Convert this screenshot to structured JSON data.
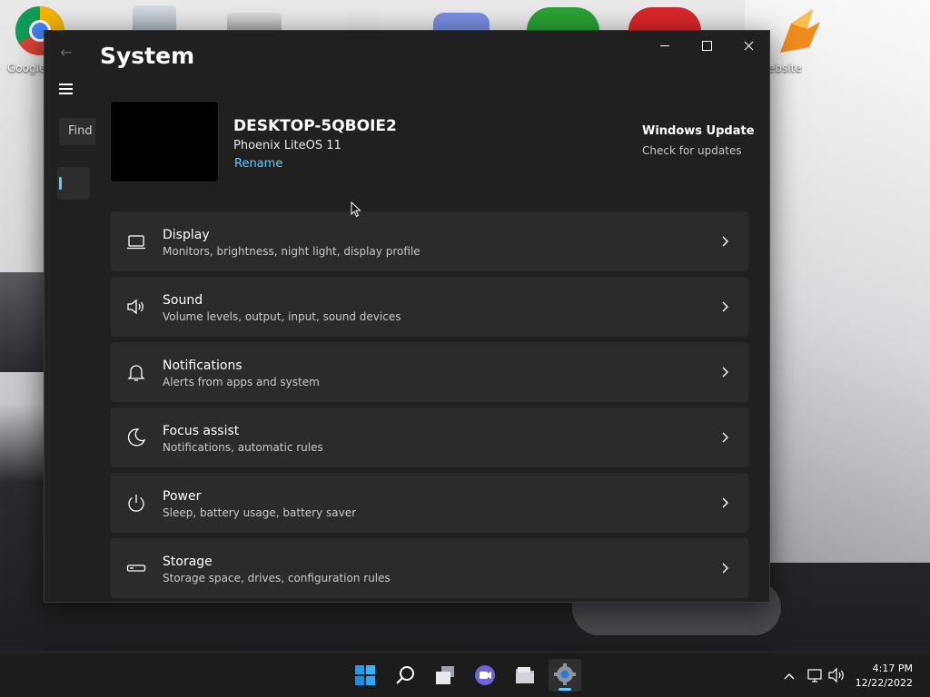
{
  "desktop": {
    "icons": [
      {
        "label": "Google",
        "icon": "chrome-icon"
      },
      {
        "label": "ebsite",
        "icon": "website-shortcut-icon"
      }
    ]
  },
  "window": {
    "title": "System",
    "search_placeholder": "Find",
    "device": {
      "name": "DESKTOP-5QBOIE2",
      "os": "Phoenix LiteOS 11",
      "rename_label": "Rename"
    },
    "windows_update": {
      "title": "Windows Update",
      "subtitle": "Check for updates"
    },
    "settings": [
      {
        "title": "Display",
        "subtitle": "Monitors, brightness, night light, display profile",
        "icon": "display-icon"
      },
      {
        "title": "Sound",
        "subtitle": "Volume levels, output, input, sound devices",
        "icon": "sound-icon"
      },
      {
        "title": "Notifications",
        "subtitle": "Alerts from apps and system",
        "icon": "bell-icon"
      },
      {
        "title": "Focus assist",
        "subtitle": "Notifications, automatic rules",
        "icon": "moon-icon"
      },
      {
        "title": "Power",
        "subtitle": "Sleep, battery usage, battery saver",
        "icon": "power-icon"
      },
      {
        "title": "Storage",
        "subtitle": "Storage space, drives, configuration rules",
        "icon": "storage-icon"
      }
    ]
  },
  "taskbar": {
    "apps": [
      "start-icon",
      "search-icon",
      "task-view-icon",
      "chat-icon",
      "file-explorer-icon",
      "settings-icon"
    ],
    "active_app": "settings-icon",
    "time": "4:17 PM",
    "date": "12/22/2022"
  },
  "colors": {
    "accent": "#60cdff",
    "window_bg": "#202020",
    "card_bg": "#2b2b2b"
  }
}
